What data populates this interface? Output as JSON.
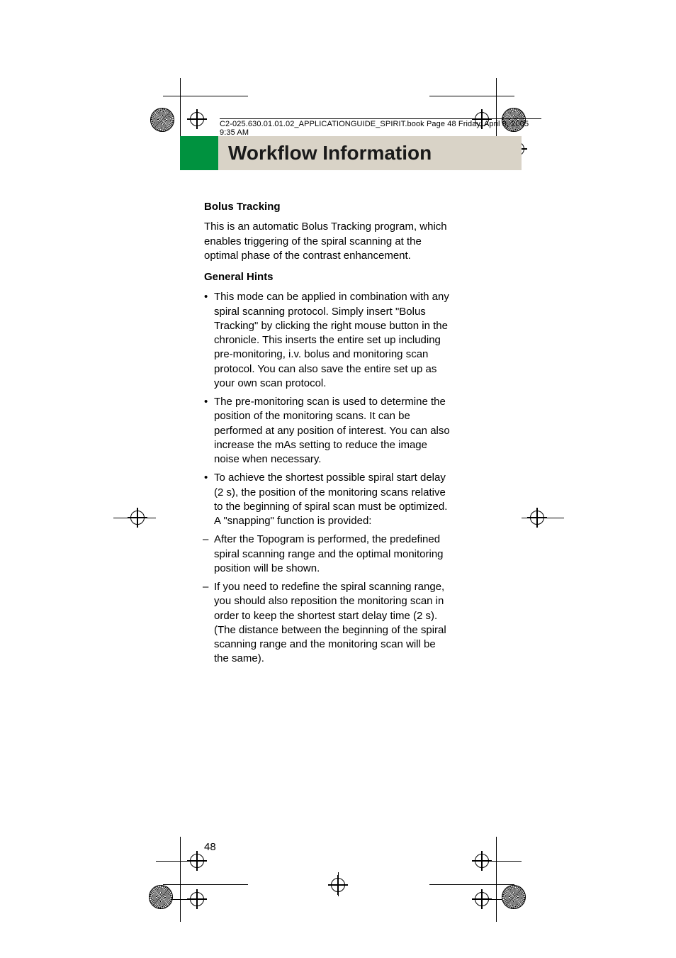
{
  "header_line": "C2-025.630.01.01.02_APPLICATIONGUIDE_SPIRIT.book  Page 48  Friday, April 8, 2005  9:35 AM",
  "title": "Workflow Information",
  "section_heading": "Bolus Tracking",
  "intro": "This is an automatic Bolus Tracking program, which enables triggering of the spiral scanning at the optimal phase of the contrast enhancement.",
  "hints_heading": "General Hints",
  "items": [
    {
      "type": "bullet",
      "text": "This mode can be applied in combination with any spiral scanning protocol. Simply insert \"Bolus Tracking\" by clicking the right mouse button in the chronicle. This inserts the entire set up including pre-monitoring, i.v. bolus and monitoring scan protocol. You can also save the entire set up as your own scan protocol."
    },
    {
      "type": "bullet",
      "text": "The pre-monitoring scan is used to determine the position of the monitoring scans. It can be performed at any position of interest. You can also increase the mAs setting to reduce the image noise when necessary."
    },
    {
      "type": "bullet",
      "text": "To achieve the shortest possible spiral start delay (2 s), the position of the monitoring scans relative to the beginning of spiral scan must be optimized. A \"snapping\" function is provided:"
    },
    {
      "type": "dash",
      "text": "After the Topogram is performed, the predefined spiral scanning range and the optimal monitoring position will be shown."
    },
    {
      "type": "dash",
      "text": "If you need to redefine the spiral scanning range, you should also reposition the monitoring scan in order to keep the shortest start delay time (2 s). (The distance between the beginning of the spiral scanning range and the monitoring scan will be the same)."
    }
  ],
  "page_number": "48"
}
